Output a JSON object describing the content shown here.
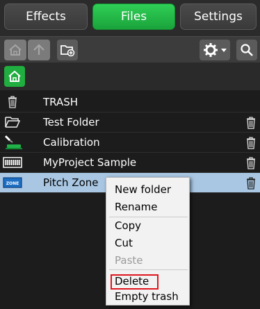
{
  "tabs": [
    {
      "label": "Effects",
      "active": false
    },
    {
      "label": "Files",
      "active": true
    },
    {
      "label": "Settings",
      "active": false
    }
  ],
  "toolbar": {
    "home_icon": "home-icon",
    "up_icon": "arrow-up-icon",
    "new_folder_icon": "new-folder-icon",
    "gear_icon": "gear-icon",
    "search_icon": "search-icon"
  },
  "breadcrumb": {
    "root_icon": "home-icon"
  },
  "files": [
    {
      "name": "TRASH",
      "icon": "trash-icon",
      "deletable": false
    },
    {
      "name": "Test Folder",
      "icon": "folder-icon",
      "deletable": true
    },
    {
      "name": "Calibration",
      "icon": "calibration-icon",
      "deletable": true
    },
    {
      "name": "MyProject Sample",
      "icon": "sample-icon",
      "deletable": true
    },
    {
      "name": "Pitch Zone",
      "icon": "zone-icon",
      "deletable": true,
      "selected": true
    }
  ],
  "zone_badge": "ZONE",
  "context_menu": {
    "items": [
      {
        "label": "New folder",
        "enabled": true
      },
      {
        "label": "Rename",
        "enabled": true
      },
      {
        "label": "Copy",
        "enabled": true
      },
      {
        "label": "Cut",
        "enabled": true
      },
      {
        "label": "Paste",
        "enabled": false
      },
      {
        "label": "Delete",
        "enabled": true,
        "highlighted": true
      },
      {
        "label": "Empty trash",
        "enabled": true
      }
    ]
  },
  "colors": {
    "active_tab": "#1aa33b",
    "selection": "#a9c7e3",
    "highlight": "#e0141e"
  }
}
